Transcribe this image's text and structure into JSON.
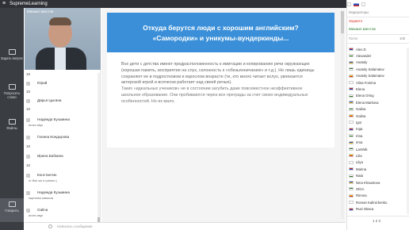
{
  "app": {
    "title": "SupremeLearning"
  },
  "leftbar": {
    "items": [
      {
        "label": "Задать вопрос"
      },
      {
        "label": "Попросить слово"
      },
      {
        "label": "Файлы"
      },
      {
        "label": "Говорить"
      }
    ]
  },
  "camera": {
    "name": "Михаил Шестов"
  },
  "chat": {
    "top_number": "10",
    "messages": [
      {
        "name": "Юрий",
        "text": "",
        "num": "10"
      },
      {
        "name": "Дарья Цыгина",
        "text": "",
        "num": "10"
      },
      {
        "name": "Надежда Кузьмина",
        "text": "исчез звук",
        "num": ""
      },
      {
        "name": "Галина Кондырова",
        "text": "",
        "num": "10"
      },
      {
        "name": "Ирина Бабкина",
        "text": "",
        "num": "10"
      },
      {
        "name": "Константин",
        "text": "от Вас же и узнали )",
        "num": ""
      },
      {
        "name": "Надежда Кузьмина",
        "text": "картинка зависла",
        "num": ""
      },
      {
        "name": "Galina",
        "text": "исчез звук",
        "num": ""
      }
    ],
    "input_placeholder": "Написать сообщение"
  },
  "slide": {
    "title_line1": "Откуда берутся люди с хорошим английским?",
    "title_line2": "«Самородки» и уникумы-вундеркинды...",
    "para1": "Все дети с детства имеют предрасположенность к имитации и копированию речи окружающих (хорошая память, восприятие на слух, склонность к «обезьянничанию» и т.д.). Но лишь единицы сохраняют ее в подростковом и взрослом возрасте (те, кто много читает вслух, увлекается актерской игрой и всячески работает над своей речью).",
    "para2": "Таких «идеальных учеников» не в состоянии загубить даже повсеместное неэффективное школьное образование. Они пробиваются через все преграды за счет своих индивидуальных особенностей. Но их мало."
  },
  "right_panel": {
    "moderators_label": "Модераторы",
    "moderators": [
      "Зорикто",
      "Михаил Шестов"
    ],
    "guests_label": "Гости",
    "guests_count": "105",
    "participants": [
      {
        "name": "Alex D",
        "flag": "#ffffff"
      },
      {
        "name": "Alexander",
        "flag": "#ffffff"
      },
      {
        "name": "Anatoly",
        "flag": "#d52b1e"
      },
      {
        "name": "Anatoly Salamatov",
        "flag": "#ffffff"
      },
      {
        "name": "Anatoly Salamatov",
        "flag": "#ffffff"
      },
      {
        "name": "Alina Fomina",
        "flag": "#ffffff"
      },
      {
        "name": "Elena",
        "flag": "#ffffff"
      },
      {
        "name": "Elena Oring",
        "flag": "#ffffff"
      },
      {
        "name": "Elena Markova",
        "flag": "#ffffff"
      },
      {
        "name": "Galina",
        "flag": "#ffffff"
      },
      {
        "name": "Galina",
        "flag": "#ffffff"
      },
      {
        "name": "Igor",
        "flag": "#ffffff"
      },
      {
        "name": "Inga",
        "flag": "#ffffff"
      },
      {
        "name": "Irina",
        "flag": "#ffffff"
      },
      {
        "name": "irma",
        "flag": "#ffffff"
      },
      {
        "name": "LarsNik",
        "flag": "#ffffff"
      },
      {
        "name": "Lilia",
        "flag": "#ffffff"
      },
      {
        "name": "Lilya",
        "flag": "#ffffff"
      },
      {
        "name": "Marina",
        "flag": "#ffffff"
      },
      {
        "name": "Nata",
        "flag": "#ffffff"
      },
      {
        "name": "Nina Khaustova",
        "flag": "#ffffff"
      },
      {
        "name": "OlGA",
        "flag": "#ffffff"
      },
      {
        "name": "Rimma",
        "flag": "#ffffff"
      },
      {
        "name": "Roman Kalinichenko",
        "flag": "#ffffff"
      },
      {
        "name": "Rusi Oksea",
        "flag": "#ffffff"
      }
    ],
    "pager": "1 2 3"
  },
  "colors": {
    "accent": "#3a8fd8",
    "topbar": "#2f3136",
    "sidebar": "#3a3d42"
  }
}
